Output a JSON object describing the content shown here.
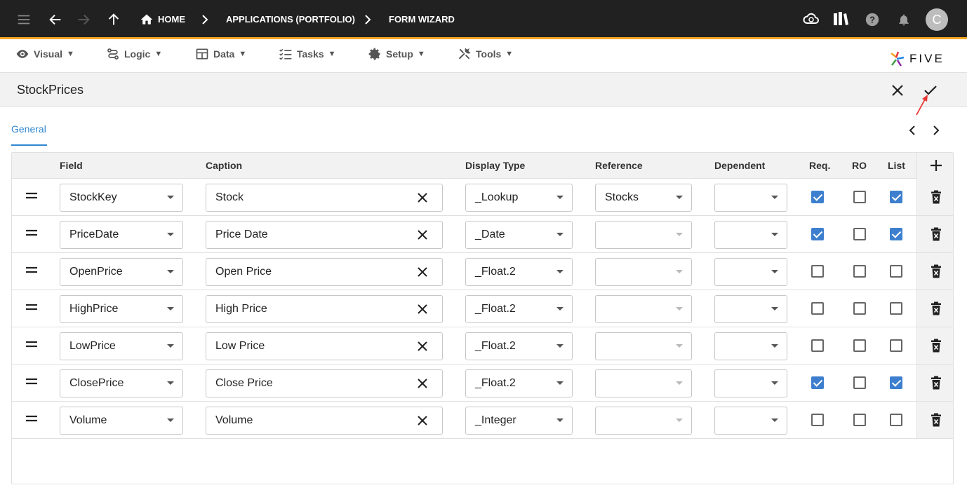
{
  "topbar": {
    "breadcrumbs": [
      "HOME",
      "APPLICATIONS (PORTFOLIO)",
      "FORM WIZARD"
    ],
    "avatar_initial": "C",
    "accent_color": "#f5a623"
  },
  "menubar": {
    "items": [
      {
        "label": "Visual",
        "icon": "eye-icon",
        "caret": "▼"
      },
      {
        "label": "Logic",
        "icon": "logic-icon",
        "caret": "▼"
      },
      {
        "label": "Data",
        "icon": "table-icon",
        "caret": "▼"
      },
      {
        "label": "Tasks",
        "icon": "tasks-icon",
        "caret": "▼"
      },
      {
        "label": "Setup",
        "icon": "gear-icon",
        "caret": "▼"
      },
      {
        "label": "Tools",
        "icon": "tools-icon",
        "caret": "▼"
      }
    ],
    "brand": "FIVE"
  },
  "form": {
    "title": "StockPrices",
    "tab": "General"
  },
  "grid": {
    "columns": [
      "Field",
      "Caption",
      "Display Type",
      "Reference",
      "Dependent",
      "Req.",
      "RO",
      "List"
    ],
    "rows": [
      {
        "field": "StockKey",
        "caption": "Stock",
        "display_type": "_Lookup",
        "reference": "Stocks",
        "dependent": "",
        "req": true,
        "ro": false,
        "list": true
      },
      {
        "field": "PriceDate",
        "caption": "Price Date",
        "display_type": "_Date",
        "reference": "",
        "dependent": "",
        "req": true,
        "ro": false,
        "list": true
      },
      {
        "field": "OpenPrice",
        "caption": "Open Price",
        "display_type": "_Float.2",
        "reference": "",
        "dependent": "",
        "req": false,
        "ro": false,
        "list": false
      },
      {
        "field": "HighPrice",
        "caption": "High Price",
        "display_type": "_Float.2",
        "reference": "",
        "dependent": "",
        "req": false,
        "ro": false,
        "list": false
      },
      {
        "field": "LowPrice",
        "caption": "Low Price",
        "display_type": "_Float.2",
        "reference": "",
        "dependent": "",
        "req": false,
        "ro": false,
        "list": false
      },
      {
        "field": "ClosePrice",
        "caption": "Close Price",
        "display_type": "_Float.2",
        "reference": "",
        "dependent": "",
        "req": true,
        "ro": false,
        "list": true
      },
      {
        "field": "Volume",
        "caption": "Volume",
        "display_type": "_Integer",
        "reference": "",
        "dependent": "",
        "req": false,
        "ro": false,
        "list": false
      }
    ],
    "checkbox_color": "#3d7fce"
  }
}
